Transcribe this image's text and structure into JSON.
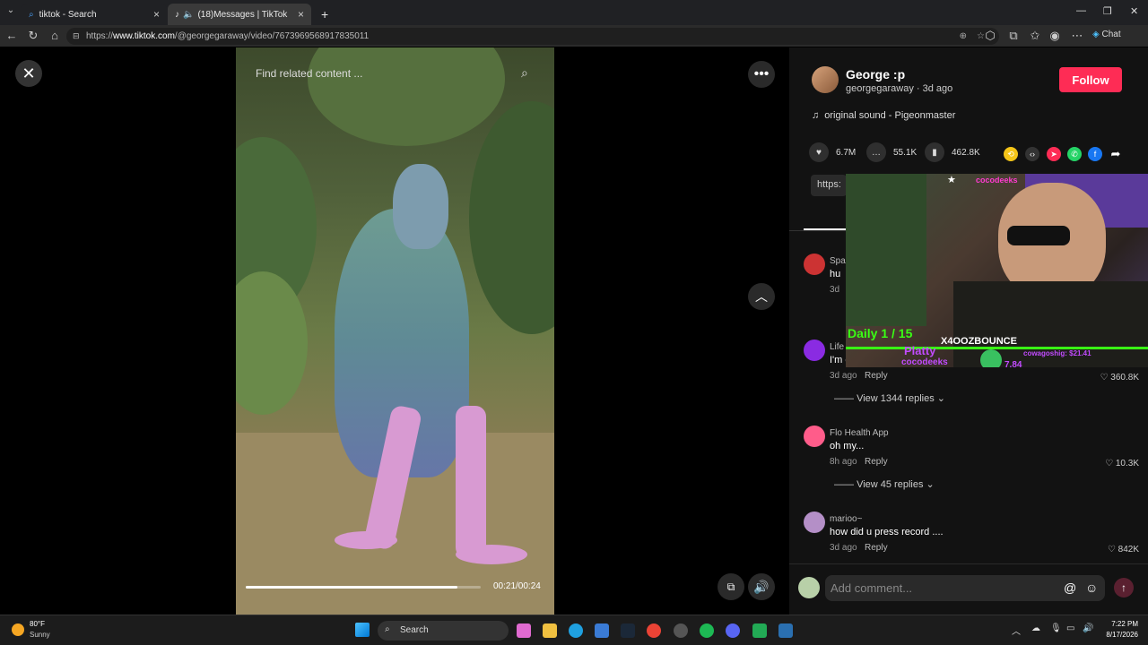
{
  "browser": {
    "tabs": [
      {
        "label": "tiktok - Search",
        "active": false
      },
      {
        "label": "(18)Messages | TikTok",
        "active": true
      }
    ],
    "url_prefix": "https://",
    "url_host": "www.tiktok.com",
    "url_path": "/@georgegaraway/video/7673969568917835011",
    "chat_label": "Chat"
  },
  "video": {
    "search_placeholder": "Find related content",
    "time": "00:21/00:24",
    "progress": 0.9
  },
  "author": {
    "name": "George :p",
    "handle": "georgegaraway",
    "ago": "3d ago",
    "follow_label": "Follow",
    "sound": "original sound - Pigeonmaster"
  },
  "stats": {
    "likes": "6.7M",
    "comments": "55.1K",
    "saves": "462.8K"
  },
  "link_preview": "https:",
  "comments": [
    {
      "name": "Spa",
      "text": "hu",
      "meta": "3d",
      "reply": "",
      "likes": ""
    },
    {
      "name": "Life",
      "text": "I'm go",
      "meta": "3d ago",
      "reply": "Reply",
      "likes": "360.8K",
      "view_replies": "View 1344 replies"
    },
    {
      "name": "Flo Health App",
      "text": "oh my...",
      "meta": "8h ago",
      "reply": "Reply",
      "likes": "10.3K",
      "view_replies": "View 45 replies"
    },
    {
      "name": "marioo~",
      "text": "how did u press record ....",
      "meta": "3d ago",
      "reply": "Reply",
      "likes": "842K"
    }
  ],
  "comment_input_placeholder": "Add comment...",
  "stream_overlay": {
    "channel": "cocodeeks",
    "daily": "Daily 1 / 15",
    "name": "X4OOZBOUNCE",
    "player": "Platty",
    "sub": "cocodeeks",
    "value": "7.84",
    "donation": "cowagoshig: $21.41"
  },
  "taskbar": {
    "weather_temp": "80°F",
    "weather_desc": "Sunny",
    "search_label": "Search",
    "time": "7:22 PM",
    "date": "8/17/2026"
  },
  "colors": {
    "follow": "#fe2c55",
    "accent_green": "#39ff14",
    "accent_purple": "#c24bff"
  }
}
